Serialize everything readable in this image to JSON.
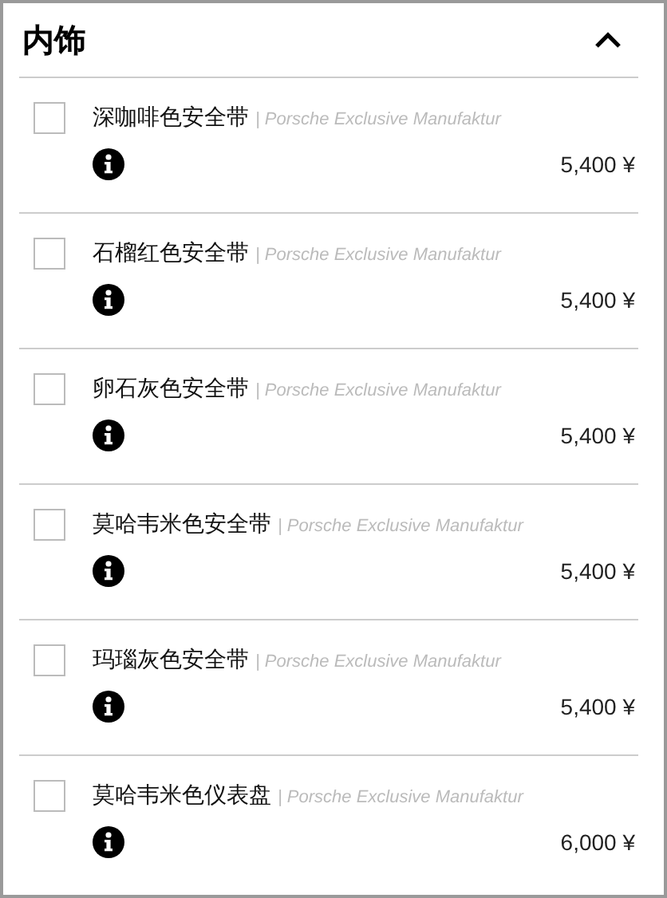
{
  "section": {
    "title": "内饰",
    "expanded": true
  },
  "options": [
    {
      "name": "深咖啡色安全带",
      "brand": "| Porsche Exclusive Manufaktur",
      "price": "5,400 ¥",
      "checked": false
    },
    {
      "name": "石榴红色安全带",
      "brand": "| Porsche Exclusive Manufaktur",
      "price": "5,400 ¥",
      "checked": false
    },
    {
      "name": "卵石灰色安全带",
      "brand": "| Porsche Exclusive Manufaktur",
      "price": "5,400 ¥",
      "checked": false
    },
    {
      "name": "莫哈韦米色安全带",
      "brand": "| Porsche Exclusive Manufaktur",
      "price": "5,400 ¥",
      "checked": false
    },
    {
      "name": "玛瑙灰色安全带",
      "brand": "| Porsche Exclusive Manufaktur",
      "price": "5,400 ¥",
      "checked": false
    },
    {
      "name": "莫哈韦米色仪表盘",
      "brand": "| Porsche Exclusive Manufaktur",
      "price": "6,000 ¥",
      "checked": false
    }
  ]
}
